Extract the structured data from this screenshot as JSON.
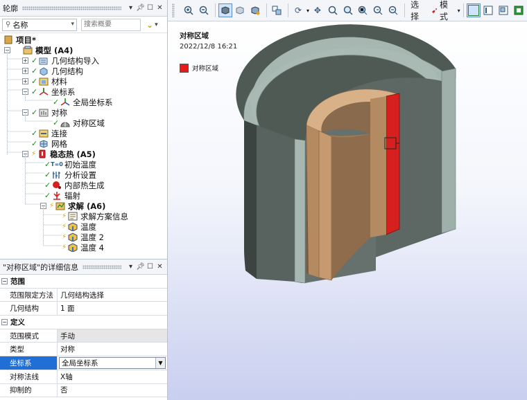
{
  "outline": {
    "title": "轮廓",
    "search_field_label": "名称",
    "search_placeholder": "搜索概要",
    "tree": [
      {
        "label": "项目*",
        "bold": true
      },
      {
        "label": "模型 (A4)",
        "bold": true
      },
      {
        "label": "几何结构导入"
      },
      {
        "label": "几何结构"
      },
      {
        "label": "材料"
      },
      {
        "label": "坐标系"
      },
      {
        "label": "全局坐标系"
      },
      {
        "label": "对称"
      },
      {
        "label": "对称区域"
      },
      {
        "label": "连接"
      },
      {
        "label": "网格"
      },
      {
        "label": "稳态热 (A5)",
        "bold": true
      },
      {
        "label": "初始温度"
      },
      {
        "label": "分析设置"
      },
      {
        "label": "内部热生成"
      },
      {
        "label": "辐射"
      },
      {
        "label": "求解 (A6)",
        "bold": true
      },
      {
        "label": "求解方案信息"
      },
      {
        "label": "温度"
      },
      {
        "label": "温度 2"
      },
      {
        "label": "温度 4"
      }
    ]
  },
  "details": {
    "title": "\"对称区域\"的详细信息",
    "sections": [
      {
        "name": "范围",
        "rows": [
          {
            "key": "范围限定方法",
            "value": "几何结构选择"
          },
          {
            "key": "几何结构",
            "value": "1 面"
          }
        ]
      },
      {
        "name": "定义",
        "rows": [
          {
            "key": "范围模式",
            "value": "手动"
          },
          {
            "key": "类型",
            "value": "对称"
          },
          {
            "key": "坐标系",
            "value": "全局坐标系"
          },
          {
            "key": "对称法线",
            "value": "X轴"
          },
          {
            "key": "抑制的",
            "value": "否"
          }
        ]
      }
    ]
  },
  "toolbar": {
    "select_label": "选择",
    "mode_label": "模式"
  },
  "viewport": {
    "title": "对称区域",
    "date": "2022/12/8 16:21",
    "legend_label": "对称区域",
    "legend_color": "#e41b1b"
  }
}
